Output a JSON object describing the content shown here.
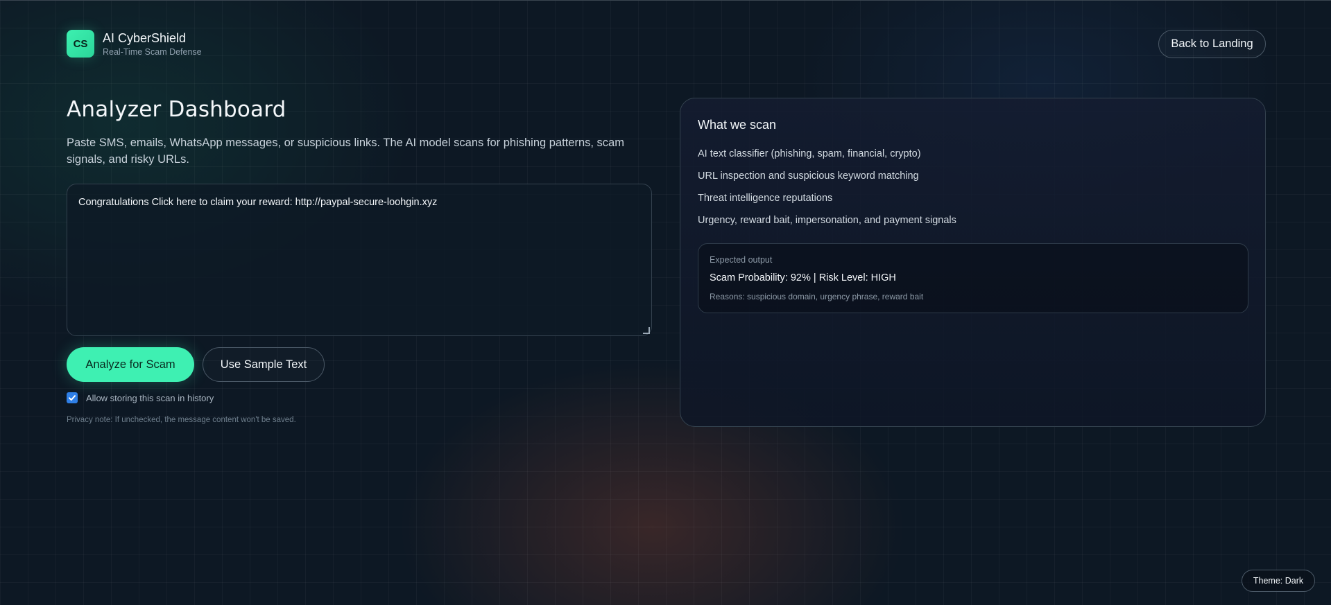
{
  "header": {
    "logo_text": "CS",
    "app_name": "AI CyberShield",
    "tagline": "Real-Time Scam Defense",
    "back_button": "Back to Landing"
  },
  "main": {
    "title": "Analyzer Dashboard",
    "subtitle": "Paste SMS, emails, WhatsApp messages, or suspicious links. The AI model scans for phishing patterns, scam signals, and risky URLs.",
    "message_input_value": "Congratulations Click here to claim your reward: http://paypal-secure-loohgin.xyz",
    "analyze_button": "Analyze for Scam",
    "sample_button": "Use Sample Text",
    "store_history_label": "Allow storing this scan in history",
    "store_history_checked": true,
    "privacy_note": "Privacy note: If unchecked, the message content won't be saved."
  },
  "panel": {
    "title": "What we scan",
    "items": [
      "AI text classifier (phishing, spam, financial, crypto)",
      "URL inspection and suspicious keyword matching",
      "Threat intelligence reputations",
      "Urgency, reward bait, impersonation, and payment signals"
    ],
    "output": {
      "label": "Expected output",
      "main": "Scam Probability: 92% | Risk Level: HIGH",
      "reasons": "Reasons: suspicious domain, urgency phrase, reward bait"
    }
  },
  "footer": {
    "theme_button": "Theme: Dark"
  },
  "colors": {
    "accent": "#3ef0b2",
    "background": "#0d1824",
    "checkbox": "#2f7fe6"
  }
}
